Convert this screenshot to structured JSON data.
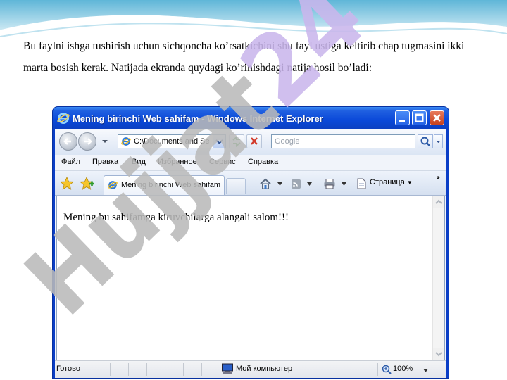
{
  "document": {
    "paragraph": "Bu faylni ishga tushirish uchun sichqoncha ko’rsatkichini shu fayl ustiga keltirib chap tugmasini ikki marta bosish kerak. Natijada ekranda quydagi ko’rinishdagi natija hosil bo’ladi:"
  },
  "watermark": {
    "text": "Hujjat24"
  },
  "ie": {
    "title": "Mening birinchi Web sahifam - Windows Internet Explorer",
    "address": "C:\\Documents and Se",
    "search_placeholder": "Google",
    "menu": [
      "Файл",
      "Правка",
      "Вид",
      "Избранное",
      "Сервис",
      "Справка"
    ],
    "menu_access_keys": [
      "Ф",
      "П",
      "В",
      "И",
      "е",
      "С"
    ],
    "tab_title": "Mening birinchi Web sahifam",
    "page_menu": "Страница",
    "page_content": "Mening bu sahifamga kiruvchilarga alangali salom!!!",
    "status": "Готово",
    "zone": "Мой компьютер",
    "zoom": "100%"
  },
  "colors": {
    "titlebar": "#0a48d8",
    "watermark": "#b9b9b9",
    "watermark_accent": "#c9b6ec"
  },
  "icons": {
    "back": "back-arrow-icon",
    "forward": "forward-arrow-icon",
    "refresh": "refresh-icon",
    "stop": "stop-icon",
    "search": "magnifier-icon",
    "favorites": "star-icon",
    "add_favorites": "add-favorite-icon",
    "home": "home-icon",
    "feeds": "rss-icon",
    "print": "printer-icon",
    "page": "page-icon",
    "computer": "computer-icon",
    "zoom": "zoom-icon"
  }
}
